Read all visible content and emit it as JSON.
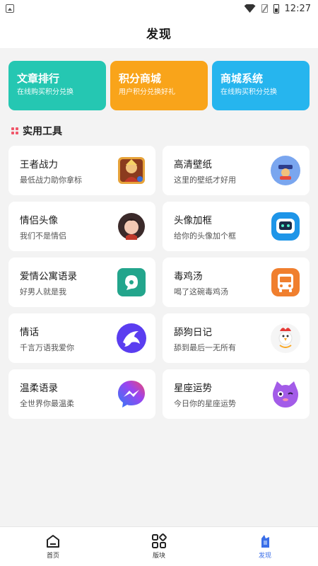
{
  "status": {
    "time": "12:27"
  },
  "header": {
    "title": "发现"
  },
  "banners": [
    {
      "title": "文章排行",
      "subtitle": "在线购买积分兑换",
      "color": "#25c7b2",
      "icon": "article-rank-icon"
    },
    {
      "title": "积分商城",
      "subtitle": "用户积分兑换好礼",
      "color": "#f9a41a",
      "icon": "points-mall-icon"
    },
    {
      "title": "商城系统",
      "subtitle": "在线购买积分兑换",
      "color": "#26b5ee",
      "icon": "mall-system-icon"
    }
  ],
  "section": {
    "title": "实用工具",
    "icon": "grid-icon",
    "accent": "#f0566a"
  },
  "tools": [
    {
      "name": "王者战力",
      "desc": "最低战力助你拿标",
      "icon": "game-hero-icon"
    },
    {
      "name": "高清壁纸",
      "desc": "这里的壁纸才好用",
      "icon": "wallpaper-icon"
    },
    {
      "name": "情侣头像",
      "desc": "我们不是情侣",
      "icon": "couple-avatar-icon"
    },
    {
      "name": "头像加框",
      "desc": "给你的头像加个框",
      "icon": "avatar-frame-icon"
    },
    {
      "name": "爱情公寓语录",
      "desc": "好男人就是我",
      "icon": "chat-bubble-icon"
    },
    {
      "name": "毒鸡汤",
      "desc": "喝了这碗毒鸡汤",
      "icon": "bus-icon"
    },
    {
      "name": "情话",
      "desc": "千言万语我爱你",
      "icon": "dolphin-icon"
    },
    {
      "name": "舔狗日记",
      "desc": "舔到最后一无所有",
      "icon": "rooster-icon"
    },
    {
      "name": "温柔语录",
      "desc": "全世界你最温柔",
      "icon": "messenger-icon"
    },
    {
      "name": "星座运势",
      "desc": "今日你的星座运势",
      "icon": "purple-cat-icon"
    }
  ],
  "tabs": [
    {
      "label": "首页",
      "icon": "home-icon",
      "active": false
    },
    {
      "label": "版块",
      "icon": "blocks-icon",
      "active": false
    },
    {
      "label": "发现",
      "icon": "discover-icon",
      "active": true
    }
  ],
  "colors": {
    "active_tab": "#3a6ee8",
    "background": "#f3f3f3"
  }
}
